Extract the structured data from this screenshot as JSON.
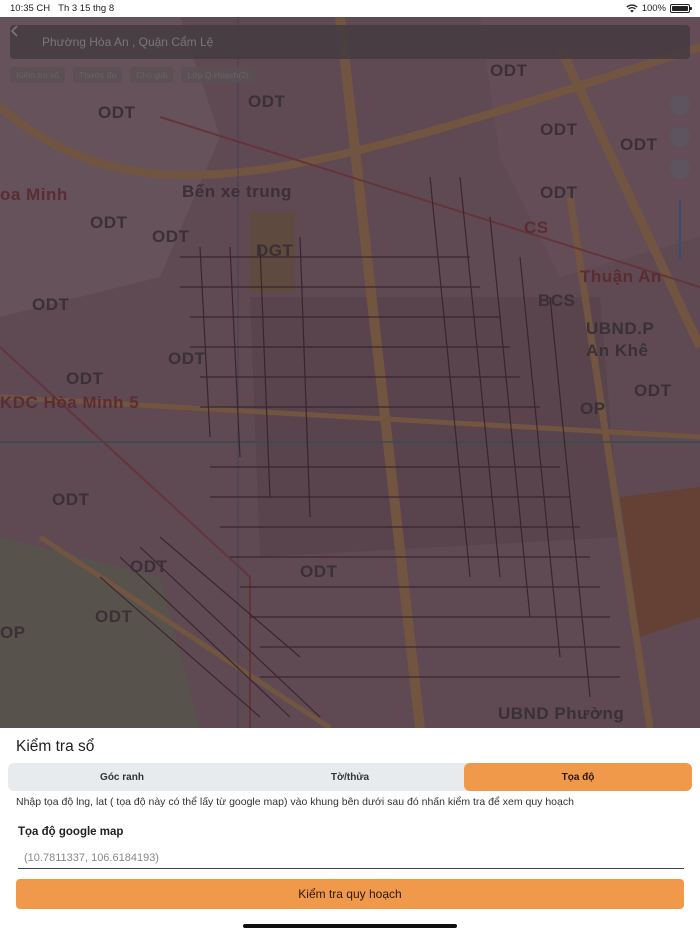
{
  "status_bar": {
    "time": "10:35 CH",
    "date": "Th 3 15 thg 8",
    "battery": "100%"
  },
  "map": {
    "header_title": "Phường Hòa An , Quận Cẩm Lệ",
    "chips": [
      "Kiểm tra sổ",
      "Thước đo",
      "Chú giải",
      "Lớp Q.Hoạch(2)"
    ],
    "labels": [
      "ODT",
      "ODT",
      "ODT",
      "ODT",
      "ODT",
      "ODT",
      "ODT",
      "ODT",
      "ODT",
      "ODT",
      "ODT",
      "ODT",
      "ODT",
      "ODT",
      "DGT",
      "UBND.P",
      "An Khê",
      "UBND Phường",
      "UBND Phường",
      "oa Minh",
      "Bến xe trung",
      "Thuận An",
      "KDC Hòa Minh 5",
      "CS",
      "BCS",
      "OP",
      "OP",
      "DGT"
    ]
  },
  "sheet": {
    "title": "Kiểm tra sổ",
    "tabs": [
      {
        "label": "Góc ranh",
        "active": false
      },
      {
        "label": "Tờ/thửa",
        "active": false
      },
      {
        "label": "Tọa độ",
        "active": true
      }
    ],
    "instruction": "Nhập tọa độ lng, lat ( tọa độ này có thể lấy từ google map) vào khung bên dưới sau đó nhấn kiểm tra để xem quy hoạch",
    "field_label": "Tọa độ google map",
    "field_placeholder": "(10.7811337, 106.6184193)",
    "field_value": "",
    "button_label": "Kiểm tra quy hoạch"
  },
  "colors": {
    "accent": "#f0994a",
    "segment_bg": "#e8ebee"
  }
}
